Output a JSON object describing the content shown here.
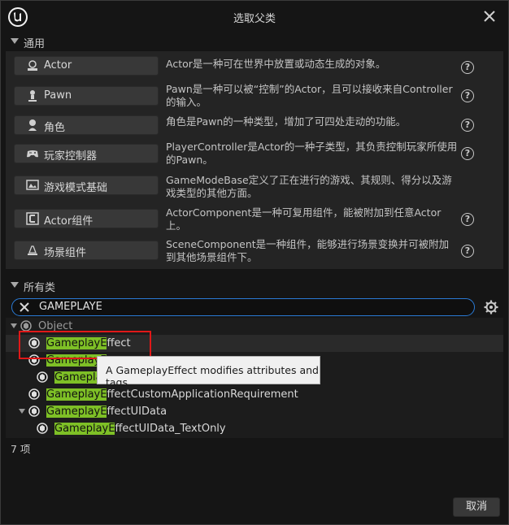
{
  "window": {
    "title": "选取父类"
  },
  "common_section": {
    "header": "通用",
    "classes": [
      {
        "label": "Actor",
        "icon": "actor-icon",
        "description": "Actor是一种可在世界中放置或动态生成的对象。"
      },
      {
        "label": "Pawn",
        "icon": "pawn-icon",
        "description": "Pawn是一种可以被“控制”的Actor，且可以接收来自Controller的输入。"
      },
      {
        "label": "角色",
        "icon": "character-icon",
        "description": "角色是Pawn的一种类型，增加了可四处走动的功能。"
      },
      {
        "label": "玩家控制器",
        "icon": "gamepad-icon",
        "description": "PlayerController是Actor的一种子类型，其负责控制玩家所使用的Pawn。"
      },
      {
        "label": "游戏模式基础",
        "icon": "gamemode-icon",
        "description": "GameModeBase定义了正在进行的游戏、其规则、得分以及游戏类型的其他方面。"
      },
      {
        "label": "Actor组件",
        "icon": "component-icon",
        "description": "ActorComponent是一种可复用组件，能被附加到任意Actor上。"
      },
      {
        "label": "场景组件",
        "icon": "scene-component-icon",
        "description": "SceneComponent是一种组件，能够进行场景变换并可被附加到其他场景组件下。"
      }
    ]
  },
  "all_classes_section": {
    "header": "所有类",
    "search_value": "GAMEPLAYE",
    "tree": [
      {
        "depth": 0,
        "expandable": true,
        "prefix": "",
        "rest": "Object"
      },
      {
        "depth": 1,
        "expandable": false,
        "prefix": "GameplayE",
        "rest": "ffect"
      },
      {
        "depth": 1,
        "expandable": false,
        "prefix": "GameplayE",
        "rest": ""
      },
      {
        "depth": 2,
        "expandable": false,
        "prefix": "Gamepla",
        "rest": ""
      },
      {
        "depth": 1,
        "expandable": false,
        "prefix": "GameplayE",
        "rest": "ffectCustomApplicationRequirement"
      },
      {
        "depth": 1,
        "expandable": true,
        "prefix": "GameplayE",
        "rest": "ffectUIData"
      },
      {
        "depth": 2,
        "expandable": false,
        "prefix": "GameplayE",
        "rest": "ffectUIData_TextOnly"
      }
    ],
    "tooltip": "A GameplayEffect modifies attributes and tags.",
    "item_count": "7 项"
  },
  "footer": {
    "cancel_label": "取消"
  },
  "colors": {
    "highlight": "#7ec026",
    "search_border": "#2a7ad5",
    "annotation": "#e01818"
  }
}
